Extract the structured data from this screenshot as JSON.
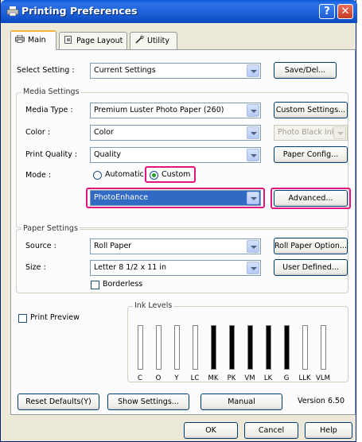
{
  "window": {
    "title": "Printing Preferences",
    "help_glyph": "?",
    "close_glyph": "✕"
  },
  "tabs": [
    {
      "label": "Main",
      "icon": "printer-icon"
    },
    {
      "label": "Page Layout",
      "icon": "page-icon"
    },
    {
      "label": "Utility",
      "icon": "wrench-icon"
    }
  ],
  "select_setting": {
    "label": "Select Setting :",
    "value": "Current Settings",
    "button": "Save/Del..."
  },
  "media_settings": {
    "title": "Media Settings",
    "media_type": {
      "label": "Media Type :",
      "value": "Premium Luster Photo Paper (260)",
      "button": "Custom Settings..."
    },
    "color": {
      "label": "Color :",
      "value": "Color",
      "ink_value": "Photo Black Ink"
    },
    "print_quality": {
      "label": "Print Quality :",
      "value": "Quality",
      "button": "Paper Config..."
    },
    "mode": {
      "label": "Mode :",
      "automatic": "Automatic",
      "custom": "Custom",
      "selected": "Custom",
      "sub_value": "PhotoEnhance",
      "advanced_button": "Advanced..."
    }
  },
  "paper_settings": {
    "title": "Paper Settings",
    "source": {
      "label": "Source :",
      "value": "Roll Paper",
      "button": "Roll Paper Option..."
    },
    "size": {
      "label": "Size :",
      "value": "Letter 8 1/2 x 11 in",
      "button": "User Defined..."
    },
    "borderless": {
      "label": "Borderless",
      "checked": false
    }
  },
  "print_preview": {
    "label": "Print Preview",
    "checked": false
  },
  "ink_levels": {
    "title": "Ink Levels",
    "inks": [
      {
        "code": "C",
        "color": "#ffffff",
        "level": 1.0
      },
      {
        "code": "O",
        "color": "#ffffff",
        "level": 1.0
      },
      {
        "code": "Y",
        "color": "#ffffff",
        "level": 1.0
      },
      {
        "code": "LC",
        "color": "#ffffff",
        "level": 1.0
      },
      {
        "code": "MK",
        "color": "#000000",
        "level": 1.0
      },
      {
        "code": "PK",
        "color": "#000000",
        "level": 1.0
      },
      {
        "code": "VM",
        "color": "#000000",
        "level": 1.0
      },
      {
        "code": "LK",
        "color": "#000000",
        "level": 1.0
      },
      {
        "code": "G",
        "color": "#000000",
        "level": 1.0
      },
      {
        "code": "LLK",
        "color": "#ffffff",
        "level": 1.0
      },
      {
        "code": "VLM",
        "color": "#ffffff",
        "level": 1.0
      }
    ]
  },
  "bottom_row": {
    "reset": "Reset Defaults(Y)",
    "show": "Show Settings...",
    "manual": "Manual",
    "version": "Version 6.50"
  },
  "footer": {
    "ok": "OK",
    "cancel": "Cancel",
    "help": "Help"
  },
  "colors": {
    "highlight": "#e0157f",
    "title_bar": "#0a58d8",
    "selection": "#316ac5"
  }
}
